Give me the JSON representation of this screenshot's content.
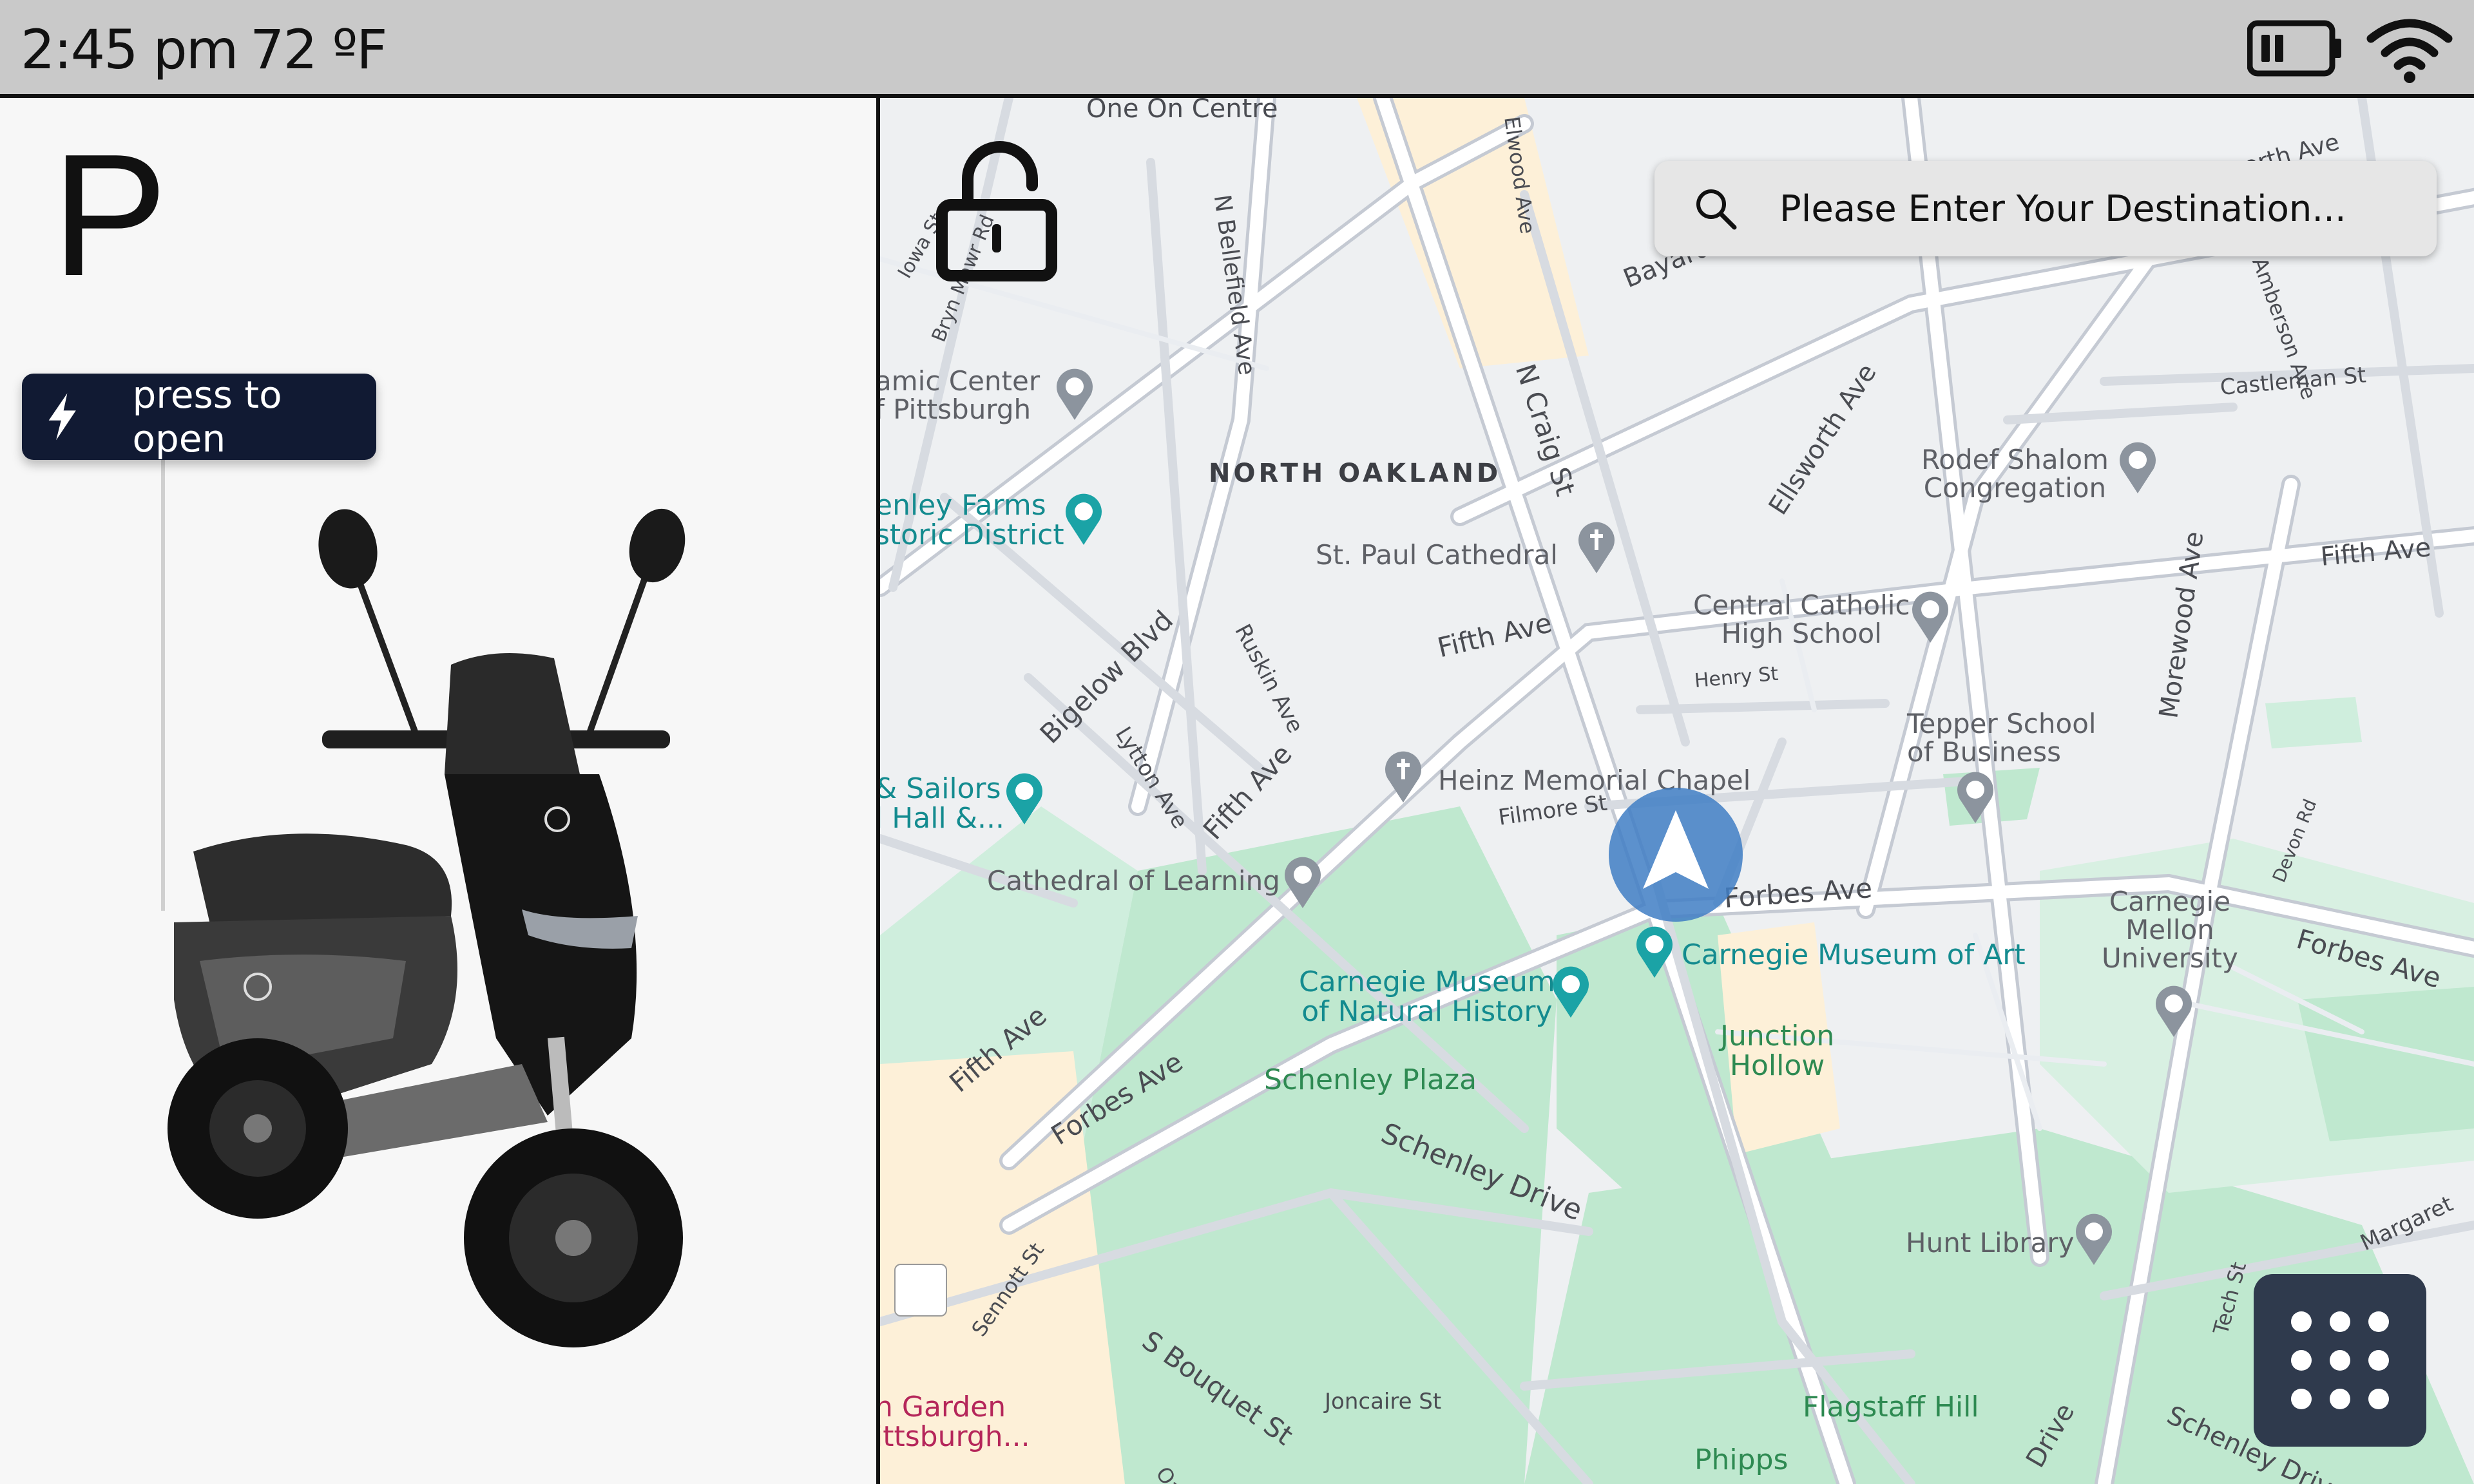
{
  "status_bar": {
    "time": "2:45 pm",
    "temperature": "72 ºF",
    "battery_icon": "battery-icon",
    "wifi_icon": "wifi-icon"
  },
  "vehicle": {
    "gear": "P",
    "open_button": {
      "label": "press to open",
      "icon": "lightning-bolt-icon"
    },
    "image": "scooter"
  },
  "map": {
    "lock_icon": "unlocked-padlock-icon",
    "search": {
      "placeholder": "Please Enter Your Destination...",
      "value": ""
    },
    "apps_icon": "grid-menu-icon",
    "nav_marker": "navigation-arrow-icon",
    "district": "NORTH OAKLAND",
    "streets": {
      "one_on_centre": "One On Centre",
      "iowa": "Iowa St",
      "bryn_mawr": "Bryn Mawr Rd",
      "n_bellefield": "N Bellefield Ave",
      "elwood": "Elwood Ave",
      "bayard": "Bayard St",
      "ellsworth_top": "Ellsworth Ave",
      "amberson": "Amberson Ave",
      "n_craig": "N Craig St",
      "ellsworth": "Ellsworth Ave",
      "castleman": "Castleman St",
      "fifth_right": "Fifth Ave",
      "fifth_mid": "Fifth Ave",
      "bigelow": "Bigelow Blvd",
      "ruskin": "Ruskin Ave",
      "henry": "Henry St",
      "lytton": "Lytton Ave",
      "fifth_lower": "Fifth Ave",
      "morewood": "Morewood Ave",
      "devon": "Devon Rd",
      "filmore": "Filmore St",
      "forbes_mid": "Forbes Ave",
      "forbes_right": "Forbes Ave",
      "fifth_bottom": "Fifth Ave",
      "forbes_left": "Forbes Ave",
      "schenley_drive": "Schenley Drive",
      "sennott": "Sennott St",
      "s_bouquet": "S Bouquet St",
      "joncaire": "Joncaire St",
      "oakland": "Oakland",
      "margaret": "Margaret",
      "tech": "Tech St",
      "schenley_drive_right": "Schenley Drive",
      "drive_bottom": "Drive"
    },
    "pois": {
      "islamic_center": "amic Center\nf Pittsburgh",
      "schenley_farms": "enley Farms\nstoric District",
      "st_paul": "St. Paul Cathedral",
      "rodef_shalom": "Rodef Shalom\nCongregation",
      "central_catholic": "Central Catholic\nHigh School",
      "tepper": "Tepper School\nof Business",
      "soldiers_sailors": "& Sailors\nl Hall &...",
      "heinz_chapel": "Heinz Memorial Chapel",
      "cathedral_learning": "Cathedral of Learning",
      "museum_art": "Carnegie Museum of Art",
      "cmu": "Carnegie\nMellon\nUniversity",
      "museum_natural": "Carnegie Museum\nof Natural History",
      "junction_hollow": "Junction\nHollow",
      "schenley_plaza": "Schenley Plaza",
      "hunt_library": "Hunt Library",
      "garden": "n Garden\nittsburgh...",
      "flagstaff": "Flagstaff Hill",
      "phipps": "Phipps"
    },
    "colors": {
      "road": "#ffffff",
      "road_outline": "#c5cad3",
      "park": "#bfe8cf",
      "campus": "#fdf0d8",
      "marker": "#3f7ec4"
    }
  }
}
